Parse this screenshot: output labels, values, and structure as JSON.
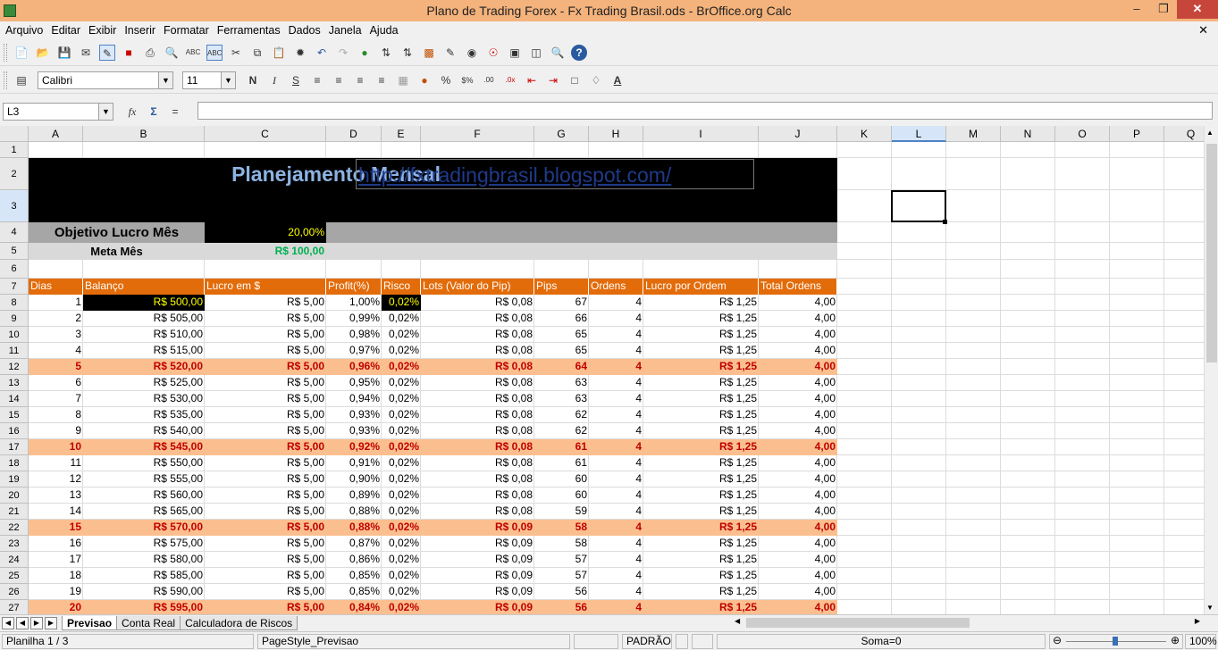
{
  "window": {
    "title": "Plano de Trading Forex - Fx Trading Brasil.ods - BrOffice.org Calc"
  },
  "menu": [
    "Arquivo",
    "Editar",
    "Exibir",
    "Inserir",
    "Formatar",
    "Ferramentas",
    "Dados",
    "Janela",
    "Ajuda"
  ],
  "format_bar": {
    "font_name": "Calibri",
    "font_size": "11"
  },
  "formula_bar": {
    "name_box": "L3",
    "formula": ""
  },
  "columns": [
    "A",
    "B",
    "C",
    "D",
    "E",
    "F",
    "G",
    "H",
    "I",
    "J",
    "K",
    "L",
    "M",
    "N",
    "O",
    "P",
    "Q"
  ],
  "active_cell": "L3",
  "sheet": {
    "title": "Planejamento Mensal",
    "url": "http://fxtradingbrasil.blogspot.com/",
    "objetivo_label": "Objetivo Lucro Mês",
    "objetivo_value": "20,00%",
    "meta_label": "Meta Mês",
    "meta_value": "R$ 100,00",
    "headers": [
      "Dias",
      "Balanço",
      "Lucro em $",
      "Profit(%)",
      "Risco",
      "Lots (Valor do  Pip)",
      "Pips",
      "Ordens",
      "Lucro por Ordem",
      "Total Ordens"
    ],
    "rows": [
      {
        "row": "8",
        "dia": "1",
        "balanco": "R$ 500,00",
        "lucro": "R$ 5,00",
        "profit": "1,00%",
        "risco": "0,02%",
        "lots": "R$ 0,08",
        "pips": "67",
        "ordens": "4",
        "lucro_ordem": "R$ 1,25",
        "total": "4,00",
        "hl": false
      },
      {
        "row": "9",
        "dia": "2",
        "balanco": "R$ 505,00",
        "lucro": "R$ 5,00",
        "profit": "0,99%",
        "risco": "0,02%",
        "lots": "R$ 0,08",
        "pips": "66",
        "ordens": "4",
        "lucro_ordem": "R$ 1,25",
        "total": "4,00",
        "hl": false
      },
      {
        "row": "10",
        "dia": "3",
        "balanco": "R$ 510,00",
        "lucro": "R$ 5,00",
        "profit": "0,98%",
        "risco": "0,02%",
        "lots": "R$ 0,08",
        "pips": "65",
        "ordens": "4",
        "lucro_ordem": "R$ 1,25",
        "total": "4,00",
        "hl": false
      },
      {
        "row": "11",
        "dia": "4",
        "balanco": "R$ 515,00",
        "lucro": "R$ 5,00",
        "profit": "0,97%",
        "risco": "0,02%",
        "lots": "R$ 0,08",
        "pips": "65",
        "ordens": "4",
        "lucro_ordem": "R$ 1,25",
        "total": "4,00",
        "hl": false
      },
      {
        "row": "12",
        "dia": "5",
        "balanco": "R$ 520,00",
        "lucro": "R$ 5,00",
        "profit": "0,96%",
        "risco": "0,02%",
        "lots": "R$ 0,08",
        "pips": "64",
        "ordens": "4",
        "lucro_ordem": "R$ 1,25",
        "total": "4,00",
        "hl": true
      },
      {
        "row": "13",
        "dia": "6",
        "balanco": "R$ 525,00",
        "lucro": "R$ 5,00",
        "profit": "0,95%",
        "risco": "0,02%",
        "lots": "R$ 0,08",
        "pips": "63",
        "ordens": "4",
        "lucro_ordem": "R$ 1,25",
        "total": "4,00",
        "hl": false
      },
      {
        "row": "14",
        "dia": "7",
        "balanco": "R$ 530,00",
        "lucro": "R$ 5,00",
        "profit": "0,94%",
        "risco": "0,02%",
        "lots": "R$ 0,08",
        "pips": "63",
        "ordens": "4",
        "lucro_ordem": "R$ 1,25",
        "total": "4,00",
        "hl": false
      },
      {
        "row": "15",
        "dia": "8",
        "balanco": "R$ 535,00",
        "lucro": "R$ 5,00",
        "profit": "0,93%",
        "risco": "0,02%",
        "lots": "R$ 0,08",
        "pips": "62",
        "ordens": "4",
        "lucro_ordem": "R$ 1,25",
        "total": "4,00",
        "hl": false
      },
      {
        "row": "16",
        "dia": "9",
        "balanco": "R$ 540,00",
        "lucro": "R$ 5,00",
        "profit": "0,93%",
        "risco": "0,02%",
        "lots": "R$ 0,08",
        "pips": "62",
        "ordens": "4",
        "lucro_ordem": "R$ 1,25",
        "total": "4,00",
        "hl": false
      },
      {
        "row": "17",
        "dia": "10",
        "balanco": "R$ 545,00",
        "lucro": "R$ 5,00",
        "profit": "0,92%",
        "risco": "0,02%",
        "lots": "R$ 0,08",
        "pips": "61",
        "ordens": "4",
        "lucro_ordem": "R$ 1,25",
        "total": "4,00",
        "hl": true
      },
      {
        "row": "18",
        "dia": "11",
        "balanco": "R$ 550,00",
        "lucro": "R$ 5,00",
        "profit": "0,91%",
        "risco": "0,02%",
        "lots": "R$ 0,08",
        "pips": "61",
        "ordens": "4",
        "lucro_ordem": "R$ 1,25",
        "total": "4,00",
        "hl": false
      },
      {
        "row": "19",
        "dia": "12",
        "balanco": "R$ 555,00",
        "lucro": "R$ 5,00",
        "profit": "0,90%",
        "risco": "0,02%",
        "lots": "R$ 0,08",
        "pips": "60",
        "ordens": "4",
        "lucro_ordem": "R$ 1,25",
        "total": "4,00",
        "hl": false
      },
      {
        "row": "20",
        "dia": "13",
        "balanco": "R$ 560,00",
        "lucro": "R$ 5,00",
        "profit": "0,89%",
        "risco": "0,02%",
        "lots": "R$ 0,08",
        "pips": "60",
        "ordens": "4",
        "lucro_ordem": "R$ 1,25",
        "total": "4,00",
        "hl": false
      },
      {
        "row": "21",
        "dia": "14",
        "balanco": "R$ 565,00",
        "lucro": "R$ 5,00",
        "profit": "0,88%",
        "risco": "0,02%",
        "lots": "R$ 0,08",
        "pips": "59",
        "ordens": "4",
        "lucro_ordem": "R$ 1,25",
        "total": "4,00",
        "hl": false
      },
      {
        "row": "22",
        "dia": "15",
        "balanco": "R$ 570,00",
        "lucro": "R$ 5,00",
        "profit": "0,88%",
        "risco": "0,02%",
        "lots": "R$ 0,09",
        "pips": "58",
        "ordens": "4",
        "lucro_ordem": "R$ 1,25",
        "total": "4,00",
        "hl": true
      },
      {
        "row": "23",
        "dia": "16",
        "balanco": "R$ 575,00",
        "lucro": "R$ 5,00",
        "profit": "0,87%",
        "risco": "0,02%",
        "lots": "R$ 0,09",
        "pips": "58",
        "ordens": "4",
        "lucro_ordem": "R$ 1,25",
        "total": "4,00",
        "hl": false
      },
      {
        "row": "24",
        "dia": "17",
        "balanco": "R$ 580,00",
        "lucro": "R$ 5,00",
        "profit": "0,86%",
        "risco": "0,02%",
        "lots": "R$ 0,09",
        "pips": "57",
        "ordens": "4",
        "lucro_ordem": "R$ 1,25",
        "total": "4,00",
        "hl": false
      },
      {
        "row": "25",
        "dia": "18",
        "balanco": "R$ 585,00",
        "lucro": "R$ 5,00",
        "profit": "0,85%",
        "risco": "0,02%",
        "lots": "R$ 0,09",
        "pips": "57",
        "ordens": "4",
        "lucro_ordem": "R$ 1,25",
        "total": "4,00",
        "hl": false
      },
      {
        "row": "26",
        "dia": "19",
        "balanco": "R$ 590,00",
        "lucro": "R$ 5,00",
        "profit": "0,85%",
        "risco": "0,02%",
        "lots": "R$ 0,09",
        "pips": "56",
        "ordens": "4",
        "lucro_ordem": "R$ 1,25",
        "total": "4,00",
        "hl": false
      },
      {
        "row": "27",
        "dia": "20",
        "balanco": "R$ 595,00",
        "lucro": "R$ 5,00",
        "profit": "0,84%",
        "risco": "0,02%",
        "lots": "R$ 0,09",
        "pips": "56",
        "ordens": "4",
        "lucro_ordem": "R$ 1,25",
        "total": "4,00",
        "hl": true
      }
    ]
  },
  "tabs": [
    {
      "label": "Previsao",
      "active": true
    },
    {
      "label": "Conta Real",
      "active": false
    },
    {
      "label": "Calculadora de Riscos",
      "active": false
    }
  ],
  "status": {
    "sheet": "Planilha 1 / 3",
    "style": "PageStyle_Previsao",
    "mode": "PADRÃO",
    "sum": "Soma=0",
    "zoom": "100%"
  },
  "colors": {
    "titlebar": "#f4b37c",
    "header_row": "#e36c0a",
    "highlight_row": "#fbbf8f",
    "highlight_text": "#c00000",
    "title_text": "#8db3e2",
    "url_text": "#1f3a8a",
    "objective_bg": "#a6a6a6",
    "meta_green": "#00b050",
    "objective_value": "#ffff00"
  }
}
